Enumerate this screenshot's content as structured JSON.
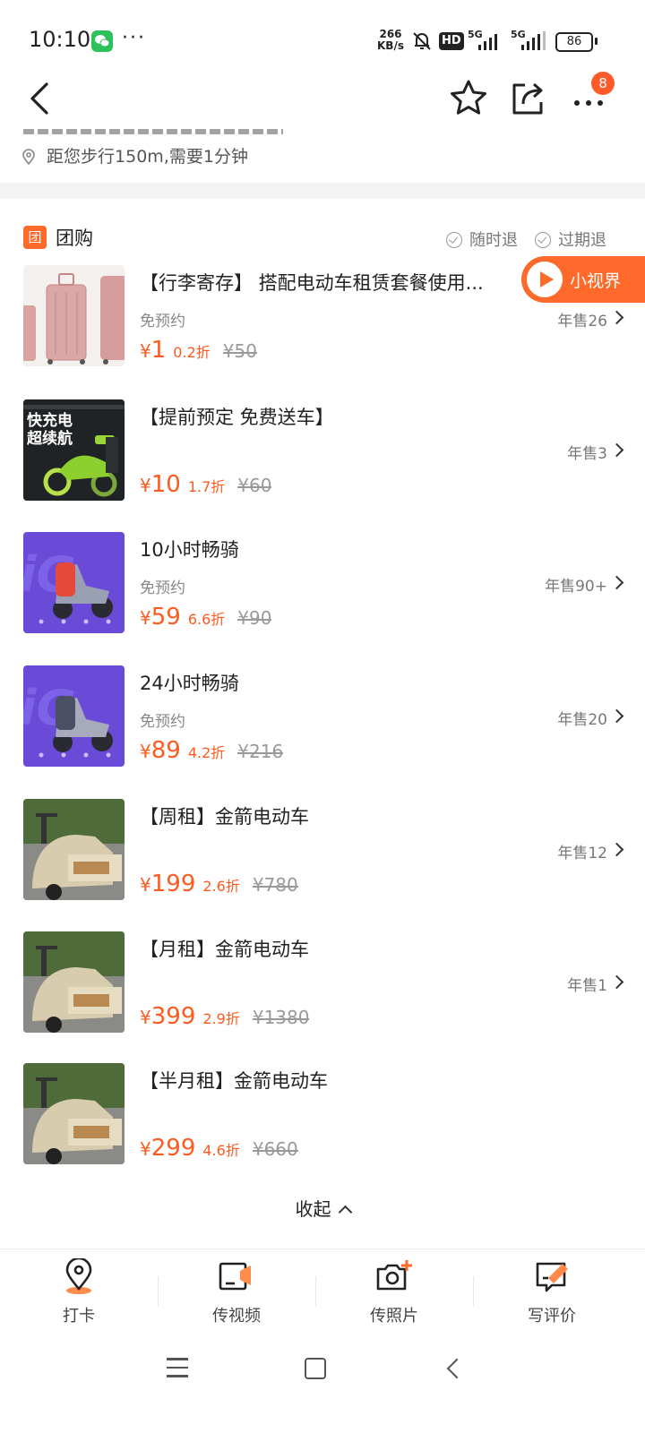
{
  "status_bar": {
    "time": "10:10",
    "dots": "···",
    "net_speed_value": "266",
    "net_speed_unit": "KB/s",
    "hd": "HD",
    "signal_1": "5G",
    "signal_2": "5G",
    "battery": "86"
  },
  "nav": {
    "badge_count": "8"
  },
  "store": {
    "distance": "距您步行150m,需要1分钟"
  },
  "group_buy": {
    "title": "团购",
    "icon_char": "团",
    "policy_1": "随时退",
    "policy_2": "过期退"
  },
  "video_pill": {
    "label": "小视界"
  },
  "deals": [
    {
      "title": "【行李寄存】 搭配电动车租赁套餐使用...",
      "subtitle": "免预约",
      "price": "1",
      "discount": "0.2折",
      "original": "50",
      "sold": "年售26"
    },
    {
      "title": "【提前预定 免费送车】",
      "subtitle": "",
      "price": "10",
      "discount": "1.7折",
      "original": "60",
      "sold": "年售3",
      "thumb_text_1": "快充电",
      "thumb_text_2": "超续航"
    },
    {
      "title": "10小时畅骑",
      "subtitle": "免预约",
      "price": "59",
      "discount": "6.6折",
      "original": "90",
      "sold": "年售90+"
    },
    {
      "title": "24小时畅骑",
      "subtitle": "免预约",
      "price": "89",
      "discount": "4.2折",
      "original": "216",
      "sold": "年售20"
    },
    {
      "title": "【周租】金箭电动车",
      "subtitle": "",
      "price": "199",
      "discount": "2.6折",
      "original": "780",
      "sold": "年售12"
    },
    {
      "title": "【月租】金箭电动车",
      "subtitle": "",
      "price": "399",
      "discount": "2.9折",
      "original": "1380",
      "sold": "年售1"
    },
    {
      "title": "【半月租】金箭电动车",
      "subtitle": "",
      "price": "299",
      "discount": "4.6折",
      "original": "660",
      "sold": ""
    }
  ],
  "currency": "¥",
  "collapse_label": "收起",
  "actions": {
    "checkin": "打卡",
    "upload_video": "传视频",
    "upload_photo": "传照片",
    "write_review": "写评价"
  },
  "colors": {
    "accent": "#ff5a1f",
    "badge": "#ff5a2b",
    "wechat": "#2dc15a"
  }
}
